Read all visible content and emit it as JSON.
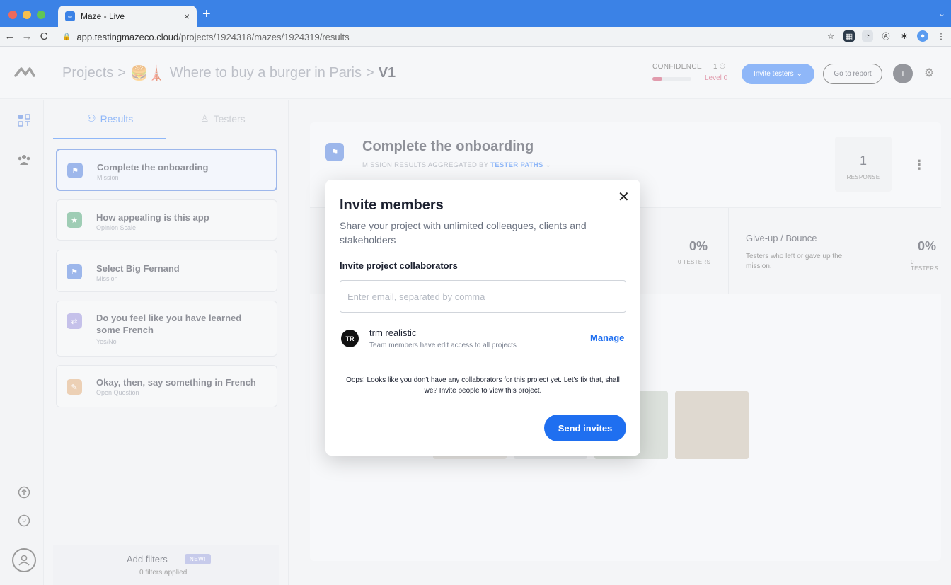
{
  "browser": {
    "tab_title": "Maze - Live",
    "tab_favicon": "maze-logo-icon",
    "url_host": "app.testingmazeco.cloud",
    "url_path": "/projects/1924318/mazes/1924319/results"
  },
  "header": {
    "breadcrumb_root": "Projects",
    "breadcrumb_sep": ">",
    "breadcrumb_project_emoji": "🍔🗼",
    "breadcrumb_project": "Where to buy a burger in Paris",
    "breadcrumb_current": "V1",
    "confidence_label": "CONFIDENCE",
    "confidence_count": "1",
    "confidence_level": "Level 0",
    "confidence_fill_fraction": 0.25,
    "invite_testers_label": "Invite testers",
    "go_to_report_label": "Go to report"
  },
  "sidepanel": {
    "tab_results": "Results",
    "tab_testers": "Testers",
    "blocks": [
      {
        "title": "Complete the onboarding",
        "type": "Mission",
        "icon": "mission-flag-icon",
        "color": "#3b6fd6"
      },
      {
        "title": "How appealing is this app",
        "type": "Opinion Scale",
        "icon": "opinion-scale-icon",
        "color": "#3f9a6b"
      },
      {
        "title": "Select Big Fernand",
        "type": "Mission",
        "icon": "mission-flag-icon",
        "color": "#3b6fd6"
      },
      {
        "title": "Do you feel like you have learned some French",
        "type": "Yes/No",
        "icon": "yes-no-icon",
        "color": "#8a83d4"
      },
      {
        "title": "Okay, then, say something in French",
        "type": "Open Question",
        "icon": "open-question-icon",
        "color": "#d9a06b"
      }
    ],
    "filters_label": "Add filters",
    "filters_badge": "NEW!",
    "filters_applied": "0 filters applied"
  },
  "main": {
    "mission_title": "Complete the onboarding",
    "mission_sub_prefix": "MISSION RESULTS AGGREGATED BY",
    "mission_sub_link": "TESTER PATHS",
    "response_count": "1",
    "response_label": "RESPONSE",
    "stat_left_pct": "0%",
    "stat_left_testers": "0 TESTERS",
    "stat_right_title": "Give-up / Bounce",
    "stat_right_desc": "Testers who left or gave up the mission.",
    "stat_right_pct": "0%",
    "stat_right_testers": "0 TESTERS"
  },
  "modal": {
    "title": "Invite members",
    "description": "Share your project with unlimited colleagues, clients and stakeholders",
    "section_title": "Invite project collaborators",
    "email_placeholder": "Enter email, separated by comma",
    "member_initials": "TR",
    "member_name": "trm realistic",
    "member_desc": "Team members have edit access to all projects",
    "manage_label": "Manage",
    "note": "Oops! Looks like you don't have any collaborators for this project yet. Let's fix that, shall we? Invite people to view this project.",
    "send_label": "Send invites"
  },
  "colors": {
    "accent": "#1f6ff0",
    "danger": "#c2375a",
    "browser_blue": "#3b82e6"
  }
}
